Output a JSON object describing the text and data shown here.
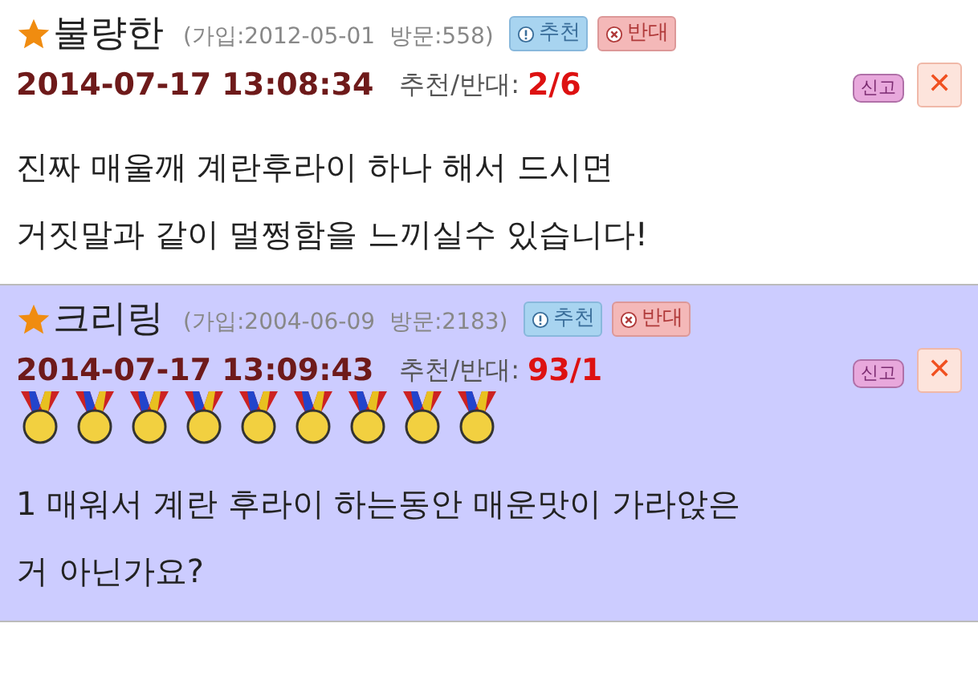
{
  "comments": [
    {
      "highlighted": false,
      "author": "불량한",
      "meta": "(가입:2012-05-01  방문:558)",
      "recommend": "추천",
      "oppose": "반대",
      "datetime": "2014-07-17 13:08:34",
      "votes_label": "추천/반대:",
      "votes": "2/6",
      "report": "신고",
      "close": "✕",
      "body": [
        "진짜 매울깨 계란후라이 하나 해서 드시면",
        "거짓말과 같이 멀쩡함을 느끼실수 있습니다!"
      ]
    },
    {
      "highlighted": true,
      "author": "크리링",
      "meta": "(가입:2004-06-09  방문:2183)",
      "recommend": "추천",
      "oppose": "반대",
      "datetime": "2014-07-17 13:09:43",
      "votes_label": "추천/반대:",
      "votes": "93/1",
      "report": "신고",
      "close": "✕",
      "medals": [
        {
          "kind": "gold"
        },
        {
          "kind": "gold"
        },
        {
          "kind": "gold"
        },
        {
          "kind": "gold"
        },
        {
          "kind": "gold"
        },
        {
          "kind": "gold"
        },
        {
          "kind": "gold"
        },
        {
          "kind": "gold"
        },
        {
          "kind": "gold"
        }
      ],
      "body": [
        "1 매워서 계란 후라이 하는동안 매운맛이 가라앉은",
        "거 아닌가요?"
      ]
    }
  ]
}
